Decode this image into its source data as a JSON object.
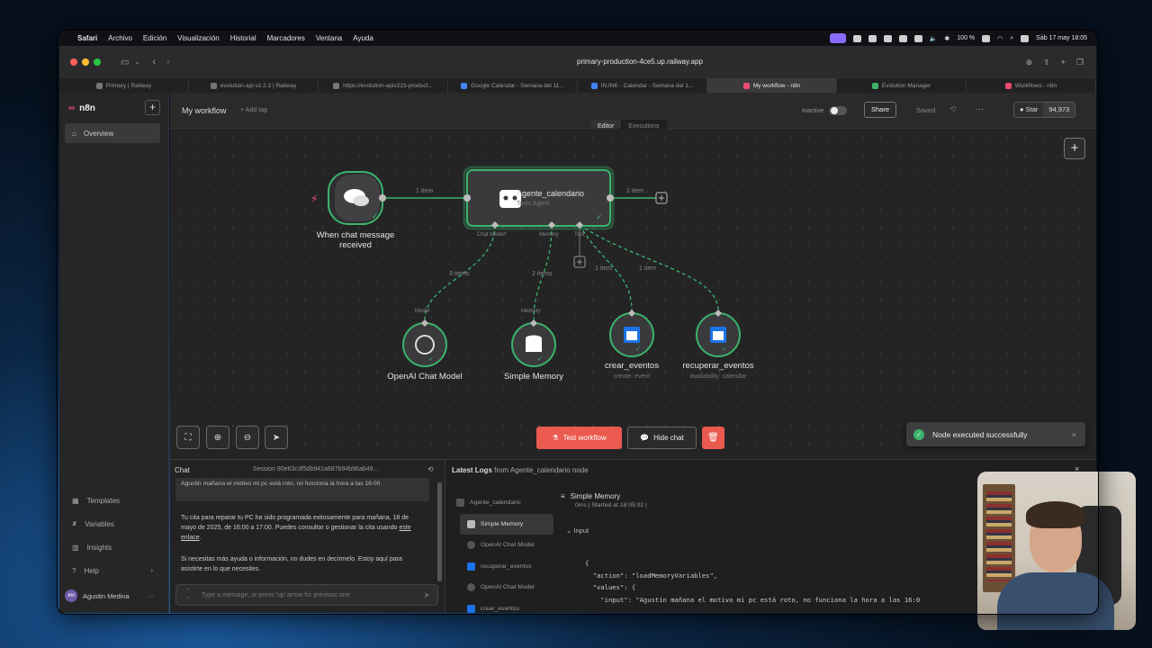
{
  "menubar": {
    "items": [
      "Safari",
      "Archivo",
      "Edición",
      "Visualización",
      "Historial",
      "Marcadores",
      "Ventana",
      "Ayuda"
    ],
    "battery": "100 %",
    "clock": "Sáb 17 may 18:05"
  },
  "browser": {
    "url": "primary-production-4ce5.up.railway.app",
    "tabs": [
      {
        "label": "Primary | Railway",
        "active": false
      },
      {
        "label": "evolution-api:v2.2.3 | Railway",
        "active": false
      },
      {
        "label": "https://evolution-apiv223-product...",
        "active": false
      },
      {
        "label": "Google Calendar - Semana del 11...",
        "active": false
      },
      {
        "label": "IN.INK - Calendar - Semana del 1...",
        "active": false
      },
      {
        "label": "My workflow - n8n",
        "active": true
      },
      {
        "label": "Evolution Manager",
        "active": false
      },
      {
        "label": "Workflows - n8n",
        "active": false
      }
    ]
  },
  "sidebar": {
    "brand": "n8n",
    "overview": "Overview",
    "bottom_items": [
      {
        "label": "Templates",
        "icon": "templates-icon"
      },
      {
        "label": "Variables",
        "icon": "variables-icon"
      },
      {
        "label": "Insights",
        "icon": "insights-icon"
      },
      {
        "label": "Help",
        "icon": "help-icon"
      }
    ],
    "user": "Agustin Medina",
    "user_initials": "AM"
  },
  "header": {
    "workflow_name": "My workflow",
    "add_tag": "+ Add tag",
    "tab_editor": "Editor",
    "tab_executions": "Executions",
    "status": "Inactive",
    "share": "Share",
    "saved": "Saved",
    "star": "Star",
    "star_count": "94,973"
  },
  "canvas": {
    "nodes": {
      "trigger": {
        "label": "When chat message received"
      },
      "agent": {
        "label": "Agente_calendario",
        "sub": "Tools Agent"
      },
      "model": {
        "label": "OpenAI Chat Model"
      },
      "memory": {
        "label": "Simple Memory"
      },
      "tool1": {
        "label": "crear_eventos",
        "sub": "create: event"
      },
      "tool2": {
        "label": "recuperar_eventos",
        "sub": "availability: calendar"
      }
    },
    "ports": {
      "chat_model": "Chat Model*",
      "memory": "Memory",
      "tool": "Tool",
      "model_in": "Model",
      "memory_in": "Memory"
    },
    "edges": {
      "trigger_agent": "1 item",
      "agent_out": "1 item",
      "model": "3 items",
      "memory": "2 items",
      "tool1": "1 item",
      "tool2": "1 item"
    },
    "buttons": {
      "test": "Test workflow",
      "hide_chat": "Hide chat"
    },
    "toast": "Node executed successfully"
  },
  "chat": {
    "title": "Chat",
    "session": "Session  90e63c3f5db941a687b94b96ab49...",
    "user_message": "Agustin mañana el motivo mi pc está roto, no funciona la hora a las 16:00",
    "bot_message_1": "Tu cita para reparar tu PC ha sido programada exitosamente para mañana, 18 de mayo de 2025, de 16:00 a 17:00. Puedes consultar o gestionar la cita usando",
    "bot_link": "este enlace",
    "bot_message_2": "Si necesitas más ayuda o información, no dudes en decírmelo. Estoy aquí para asistirte en lo que necesites.",
    "input_placeholder": "Type a message, or press 'up' arrow for previous one"
  },
  "logs": {
    "title_bold": "Latest Logs",
    "title_rest": "from Agente_calendario node",
    "tree": [
      {
        "label": "Agente_calendario",
        "level": "root",
        "selected": false
      },
      {
        "label": "Simple Memory",
        "level": "child",
        "selected": true
      },
      {
        "label": "OpenAI Chat Model",
        "level": "child",
        "selected": false
      },
      {
        "label": "recuperar_eventos",
        "level": "child",
        "selected": false
      },
      {
        "label": "OpenAI Chat Model",
        "level": "child",
        "selected": false
      },
      {
        "label": "crear_eventos",
        "level": "child",
        "selected": false
      }
    ],
    "detail_title": "Simple Memory",
    "detail_sub": "0ms | Started at 18:05:02 |",
    "input_label": "Input",
    "code_lines": [
      "{",
      "  \"action\": \"loadMemoryVariables\",",
      "  \"values\": {",
      "    \"input\": \"Agustin mañana el motivo mi pc está roto, no funciona la hora a las 16:0"
    ]
  },
  "colors": {
    "accent": "#ea5a4f",
    "success": "#3bb36b",
    "brand": "#ea4b71",
    "node_border": "#3bb36b"
  }
}
